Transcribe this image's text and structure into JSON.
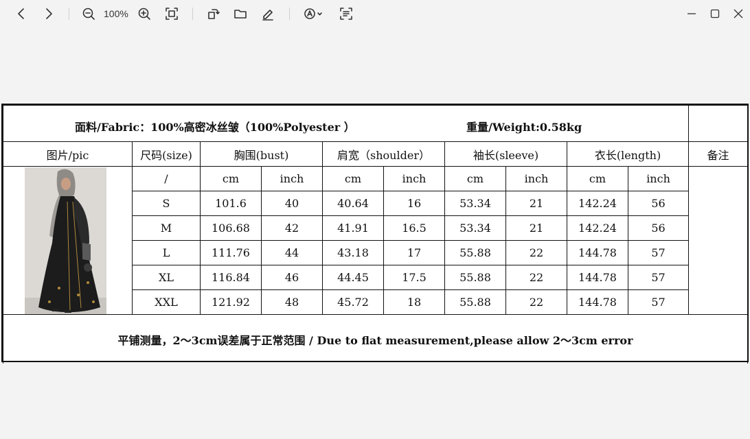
{
  "toolbar": {
    "zoom_level": "100%",
    "icons": [
      "back-icon",
      "forward-icon",
      "zoom-out-icon",
      "zoom-in-icon",
      "fit-icon",
      "rotate-icon",
      "folder-icon",
      "edit-icon",
      "ocr-icon",
      "text-select-icon"
    ]
  },
  "window": {
    "icons": [
      "minimize-icon",
      "maximize-icon",
      "close-icon"
    ]
  },
  "table": {
    "fabric": "面料/Fabric：100%高密冰丝皱（100%Polyester ）",
    "weight": "重量/Weight:0.58kg",
    "headers": {
      "pic": "图片/pic",
      "size": "尺码(size)",
      "bust": "胸围(bust)",
      "shoulder": "肩宽（shoulder）",
      "sleeve": "袖长(sleeve)",
      "length": "衣长(length)",
      "remark": "备注"
    },
    "units": [
      "/",
      "cm",
      "inch",
      "cm",
      "inch",
      "cm",
      "inch",
      "cm",
      "inch"
    ],
    "rows": [
      [
        "S",
        "101.6",
        "40",
        "40.64",
        "16",
        "53.34",
        "21",
        "142.24",
        "56"
      ],
      [
        "M",
        "106.68",
        "42",
        "41.91",
        "16.5",
        "53.34",
        "21",
        "142.24",
        "56"
      ],
      [
        "L",
        "111.76",
        "44",
        "43.18",
        "17",
        "55.88",
        "22",
        "144.78",
        "57"
      ],
      [
        "XL",
        "116.84",
        "46",
        "44.45",
        "17.5",
        "55.88",
        "22",
        "144.78",
        "57"
      ],
      [
        "XXL",
        "121.92",
        "48",
        "45.72",
        "18",
        "55.88",
        "22",
        "144.78",
        "57"
      ]
    ],
    "note": "平铺测量，2～3cm误差属于正常范围 / Due to flat measurement,please allow 2～3cm error"
  }
}
